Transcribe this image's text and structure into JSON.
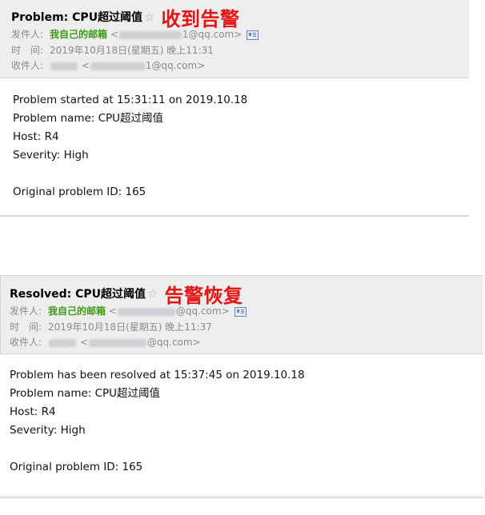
{
  "emails": [
    {
      "subject": "Problem: CPU超过阈值",
      "annotation": "收到告警",
      "from_label": "发件人:",
      "from_name": "我自己的邮箱",
      "from_email_open": "<",
      "from_email_suffix": "1@qq.com>",
      "time_label": "时　间:",
      "time_value": "2019年10月18日(星期五) 晚上11:31",
      "to_label": "收件人:",
      "to_email_open": "<",
      "to_email_suffix": "1@qq.com>",
      "body_lines": [
        "Problem started at 15:31:11 on 2019.10.18",
        "Problem name: CPU超过阈值",
        "Host: R4",
        "Severity: High",
        "",
        "Original problem ID: 165"
      ]
    },
    {
      "subject": "Resolved: CPU超过阈值",
      "annotation": "告警恢复",
      "from_label": "发件人:",
      "from_name": "我自己的邮箱",
      "from_email_open": "<",
      "from_email_suffix": "@qq.com>",
      "time_label": "时　间:",
      "time_value": "2019年10月18日(星期五) 晚上11:37",
      "to_label": "收件人:",
      "to_email_open": "<",
      "to_email_suffix": "@qq.com>",
      "body_lines": [
        "Problem has been resolved at 15:37:45 on 2019.10.18",
        "Problem name: CPU超过阈值",
        "Host: R4",
        "Severity: High",
        "",
        "Original problem ID: 165"
      ]
    }
  ],
  "icons": {
    "star": "star-outline-icon",
    "contact_card": "contact-card-icon"
  },
  "colors": {
    "annotation": "#e81313",
    "sender_name": "#3b9c13",
    "header_bg": "#eeeeee",
    "meta_text": "#8a8a8a"
  }
}
